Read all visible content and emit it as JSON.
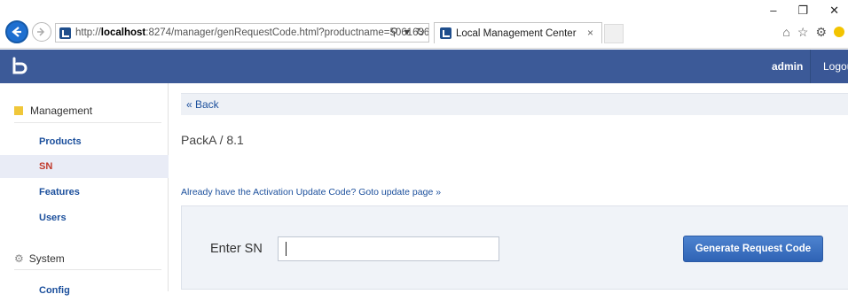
{
  "browser": {
    "url_prefix": "http://",
    "url_host": "localhost",
    "url_rest": ":8274/manager/genRequestCode.html?productname=5061636B",
    "search_icon": "search-icon",
    "refresh_icon": "refresh-icon",
    "tab_title": "Local Management Center",
    "tab_close": "×",
    "win_min": "–",
    "win_restore": "❐",
    "win_close": "✕"
  },
  "header": {
    "user": "admin",
    "logout": "Logou"
  },
  "sidebar": {
    "management_label": "Management",
    "items": [
      {
        "label": "Products",
        "active": false
      },
      {
        "label": "SN",
        "active": true
      },
      {
        "label": "Features",
        "active": false
      },
      {
        "label": "Users",
        "active": false
      }
    ],
    "system_label": "System",
    "config_label": "Config"
  },
  "main": {
    "back_link": "« Back",
    "breadcrumb": "PackA / 8.1",
    "update_link": "Already have the Activation Update Code? Goto update page »",
    "sn_label": "Enter SN",
    "sn_value": "",
    "generate_button": "Generate Request Code"
  },
  "colors": {
    "appbar": "#3c5a98",
    "link": "#1b4f9c",
    "active_item": "#c0392b",
    "button": "#2f63b5"
  }
}
